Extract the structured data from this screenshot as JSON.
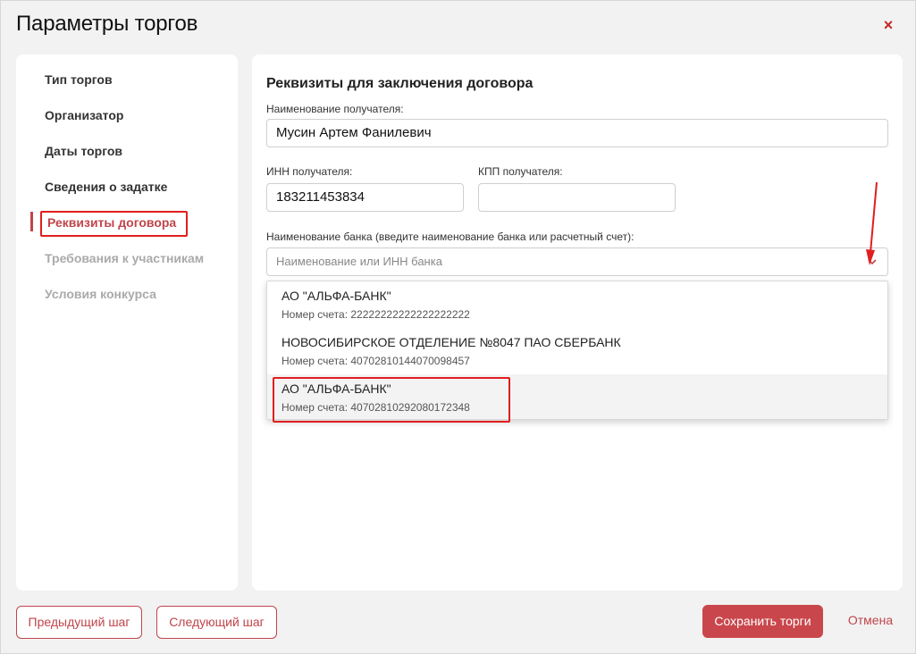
{
  "dialog": {
    "title": "Параметры торгов",
    "close_label": "×"
  },
  "sidebar": {
    "items": [
      {
        "label": "Тип торгов",
        "state": "enabled"
      },
      {
        "label": "Организатор",
        "state": "enabled"
      },
      {
        "label": "Даты торгов",
        "state": "enabled"
      },
      {
        "label": "Сведения о задатке",
        "state": "enabled"
      },
      {
        "label": "Реквизиты договора",
        "state": "active"
      },
      {
        "label": "Требования к участникам",
        "state": "disabled"
      },
      {
        "label": "Условия конкурса",
        "state": "disabled"
      }
    ]
  },
  "form": {
    "section_title": "Реквизиты для заключения договора",
    "recipient_name_label": "Наименование получателя:",
    "recipient_name_value": "Мусин Артем Фанилевич",
    "inn_label": "ИНН получателя:",
    "inn_value": "183211453834",
    "kpp_label": "КПП получателя:",
    "kpp_value": "",
    "bank_label": "Наименование банка (введите наименование банка или расчетный счет):",
    "bank_placeholder": "Наименование или ИНН банка"
  },
  "bank_options": [
    {
      "name": "АО \"АЛЬФА-БАНК\"",
      "account": "Номер счета: 22222222222222222222"
    },
    {
      "name": "НОВОСИБИРСКОЕ ОТДЕЛЕНИЕ №8047 ПАО СБЕРБАНК",
      "account": "Номер счета: 40702810144070098457"
    },
    {
      "name": "АО \"АЛЬФА-БАНК\"",
      "account": "Номер счета: 40702810292080172348"
    }
  ],
  "footer": {
    "prev_label": "Предыдущий шаг",
    "next_label": "Следующий шаг",
    "save_label": "Сохранить торги",
    "cancel_label": "Отмена"
  },
  "colors": {
    "accent": "#c0454a",
    "annotation": "#e01e1e"
  }
}
